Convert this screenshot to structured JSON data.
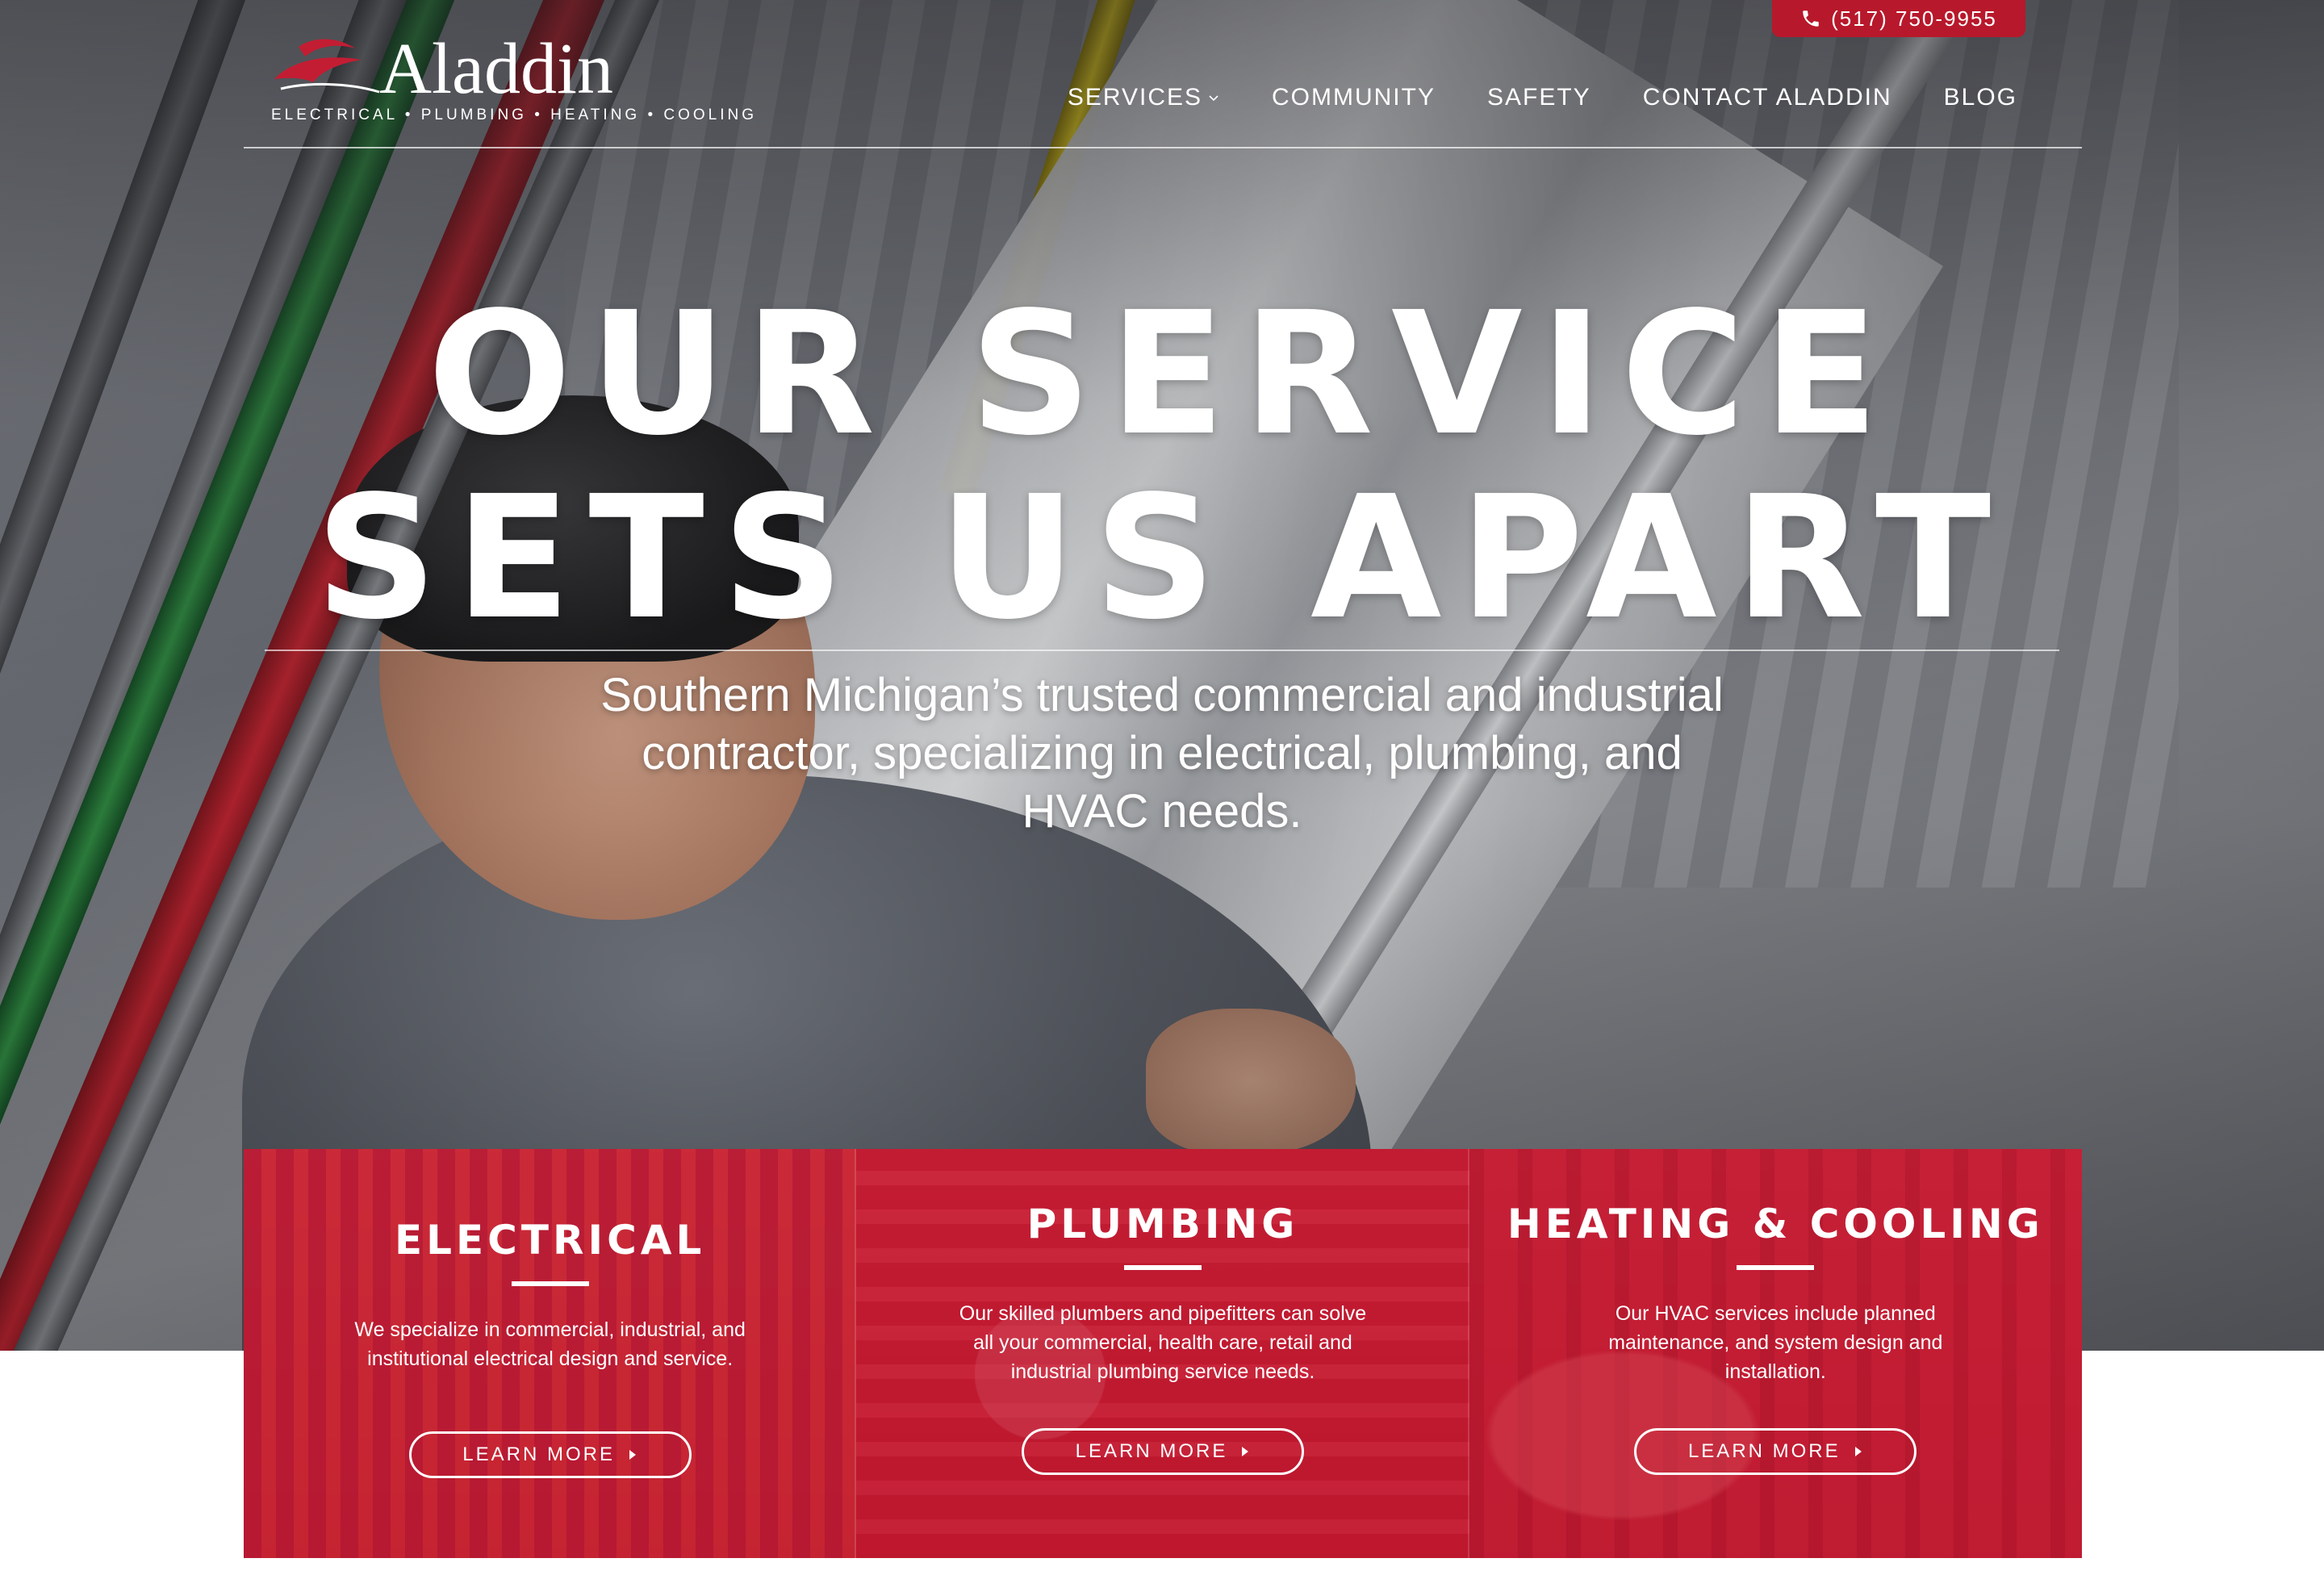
{
  "header": {
    "phone": "(517) 750-9955",
    "logo": {
      "brand": "Aladdin",
      "tagline": "ELECTRICAL • PLUMBING • HEATING • COOLING"
    },
    "nav": [
      {
        "label": "SERVICES",
        "has_dropdown": true
      },
      {
        "label": "COMMUNITY"
      },
      {
        "label": "SAFETY"
      },
      {
        "label": "CONTACT ALADDIN"
      },
      {
        "label": "BLOG"
      }
    ]
  },
  "hero": {
    "title_line1": "OUR SERVICE",
    "title_line2": "SETS US APART",
    "subtitle": "Southern Michigan’s trusted commercial and industrial contractor, specializing in electrical, plumbing, and HVAC needs."
  },
  "services": [
    {
      "title": "ELECTRICAL",
      "description": "We specialize in commercial, industrial, and institutional electrical design and service.",
      "button": "LEARN MORE"
    },
    {
      "title": "PLUMBING",
      "description": "Our skilled plumbers and pipefitters can solve all your commercial, health care, retail and industrial plumbing service needs.",
      "button": "LEARN MORE"
    },
    {
      "title": "HEATING & COOLING",
      "description": "Our HVAC services include planned maintenance, and system design and installation.",
      "button": "LEARN MORE"
    }
  ],
  "colors": {
    "brand_red": "#c31d33",
    "phone_tab_red": "#b8182b",
    "text_white": "#ffffff"
  },
  "icons": [
    "phone-icon",
    "chevron-down-icon",
    "caret-right-icon",
    "logo-swoosh-icon"
  ]
}
